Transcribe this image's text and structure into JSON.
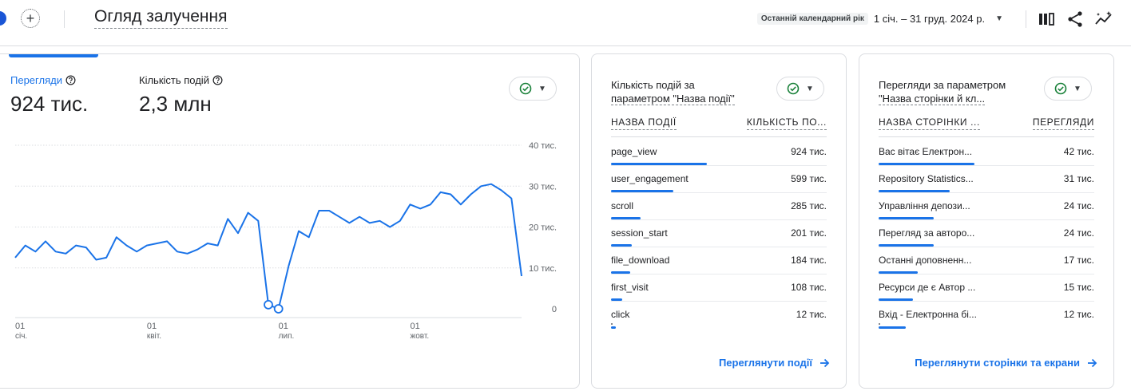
{
  "header": {
    "title": "Огляд залучення",
    "add_icon_glyph": "+",
    "date_preset": "Останній календарний рік",
    "date_range": "1 січ. – 31 груд. 2024 р.",
    "dropdown_icon": "▼",
    "icons": [
      "add-icon",
      "compare-icon",
      "share-icon",
      "insights-icon"
    ]
  },
  "main_card": {
    "metrics": [
      {
        "label": "Перегляди",
        "value": "924 тис."
      },
      {
        "label": "Кількість подій",
        "value": "2,3 млн"
      }
    ],
    "chart_data": {
      "type": "line",
      "series": [
        {
          "values": [
            12.5,
            15.5,
            14.0,
            16.5,
            14.0,
            13.5,
            15.5,
            15.0,
            12.0,
            12.5,
            17.5,
            15.5,
            14.0,
            15.5,
            16.0,
            16.5,
            14.0,
            13.5,
            14.5,
            16.0,
            15.5,
            22.0,
            18.5,
            23.5,
            21.5,
            1.0,
            0.0,
            10.5,
            19.0,
            17.5,
            24.0,
            24.0,
            22.5,
            21.0,
            22.5,
            21.0,
            21.5,
            20.0,
            21.5,
            25.5,
            24.5,
            25.5,
            28.5,
            28.0,
            25.5,
            28.0,
            30.0,
            30.5,
            29.0,
            27.0,
            8.0
          ]
        }
      ],
      "x_tick_labels": [
        {
          "day": "01",
          "month": "січ."
        },
        {
          "day": "01",
          "month": "квіт."
        },
        {
          "day": "01",
          "month": "лип."
        },
        {
          "day": "01",
          "month": "жовт."
        }
      ],
      "x_tick_indices": [
        0,
        13,
        26,
        39
      ],
      "y_ticks": [
        {
          "value": 0,
          "label": "0"
        },
        {
          "value": 10,
          "label": "10 тис."
        },
        {
          "value": 20,
          "label": "20 тис."
        },
        {
          "value": 30,
          "label": "30 тис."
        },
        {
          "value": 40,
          "label": "40 тис."
        }
      ],
      "ylim": [
        0,
        40
      ],
      "highlighted_points": [
        25,
        26
      ],
      "color": "#1a73e8",
      "grid": true
    }
  },
  "events_card": {
    "title_line1": "Кількість подій за",
    "title_line2": "параметром \"Назва події\"",
    "col_left": "НАЗВА ПОДІЇ",
    "col_right": "КІЛЬКІСТЬ ПО...",
    "rows": [
      {
        "name": "page_view",
        "value": "924 тис.",
        "share": 1.0
      },
      {
        "name": "user_engagement",
        "value": "599 тис.",
        "share": 0.648
      },
      {
        "name": "scroll",
        "value": "285 тис.",
        "share": 0.308
      },
      {
        "name": "session_start",
        "value": "201 тис.",
        "share": 0.218
      },
      {
        "name": "file_download",
        "value": "184 тис.",
        "share": 0.199
      },
      {
        "name": "first_visit",
        "value": "108 тис.",
        "share": 0.117
      },
      {
        "name": "click",
        "value": "12 тис.",
        "share": 0.013
      }
    ],
    "link": "Переглянути події"
  },
  "pages_card": {
    "title_line1": "Перегляди за параметром",
    "title_line2": "\"Назва сторінки й кл...",
    "col_left": "НАЗВА СТОРІНКИ ...",
    "col_right": "ПЕРЕГЛЯДИ",
    "rows": [
      {
        "name": "Вас вітає Електрон...",
        "value": "42 тис.",
        "share": 1.0
      },
      {
        "name": "Repository Statistics...",
        "value": "31 тис.",
        "share": 0.738
      },
      {
        "name": "Управління депози...",
        "value": "24 тис.",
        "share": 0.571
      },
      {
        "name": "Перегляд за авторо...",
        "value": "24 тис.",
        "share": 0.571
      },
      {
        "name": "Останні доповненн...",
        "value": "17 тис.",
        "share": 0.405
      },
      {
        "name": "Ресурси де є Автор ...",
        "value": "15 тис.",
        "share": 0.357
      },
      {
        "name": "Вхід - Електронна бі...",
        "value": "12 тис.",
        "share": 0.286
      }
    ],
    "link": "Переглянути сторінки та екрани"
  },
  "colors": {
    "accent": "#1a73e8",
    "status_ok": "#188038",
    "border": "#dadce0"
  }
}
